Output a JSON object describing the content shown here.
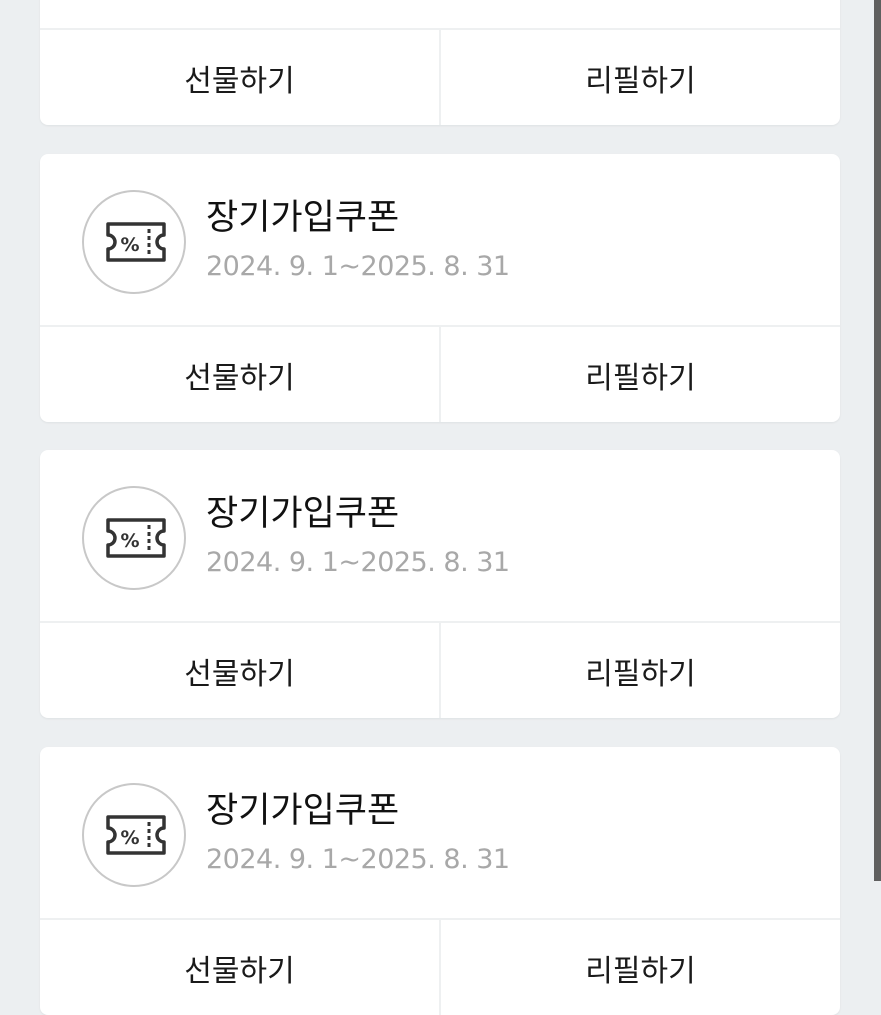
{
  "cards": [
    {
      "title": "",
      "period": "",
      "gift_label": "선물하기",
      "refill_label": "리필하기"
    },
    {
      "title": "장기가입쿠폰",
      "period": "2024. 9. 1~2025. 8. 31",
      "gift_label": "선물하기",
      "refill_label": "리필하기"
    },
    {
      "title": "장기가입쿠폰",
      "period": "2024. 9. 1~2025. 8. 31",
      "gift_label": "선물하기",
      "refill_label": "리필하기"
    },
    {
      "title": "장기가입쿠폰",
      "period": "2024. 9. 1~2025. 8. 31",
      "gift_label": "선물하기",
      "refill_label": "리필하기"
    }
  ],
  "icons": {
    "coupon": "ticket-percent-icon"
  },
  "colors": {
    "background": "#eceff1",
    "card": "#ffffff",
    "title": "#111111",
    "period": "#a8a8a8",
    "icon_stroke": "#333333",
    "icon_circle": "#c8c8c8"
  }
}
